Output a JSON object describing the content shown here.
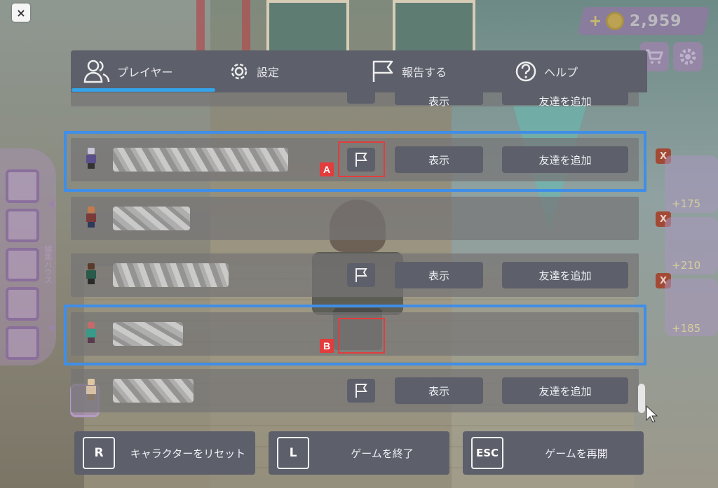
{
  "close_button": {
    "label": "×"
  },
  "currency": {
    "plus": "+",
    "amount": "2,959",
    "coin_icon": "gear-coin-icon"
  },
  "top_right_icons": [
    "shopping-cart-icon",
    "gear-icon"
  ],
  "left_toolbar": {
    "icons": [
      "hammer-wrench-icon",
      "frame-icon",
      "download-icon",
      "paint-roller-icon",
      "gear-icon"
    ],
    "vertical_label": "編集ハウス"
  },
  "inventory": [
    {
      "price": "+175",
      "icon": "fish-icon"
    },
    {
      "price": "+210",
      "icon": "computer-desk-icon"
    },
    {
      "price": "+185",
      "icon": "yellow-character-icon"
    }
  ],
  "inventory_remove_label": "X",
  "tabs": [
    {
      "label": "プレイヤー",
      "icon": "players-icon",
      "active": true
    },
    {
      "label": "設定",
      "icon": "gear-icon",
      "active": false
    },
    {
      "label": "報告する",
      "icon": "flag-icon",
      "active": false
    },
    {
      "label": "ヘルプ",
      "icon": "help-icon",
      "active": false
    }
  ],
  "players": [
    {
      "has_actions": true,
      "partial": true
    },
    {
      "has_actions": true,
      "annotation": "A"
    },
    {
      "has_actions": false
    },
    {
      "has_actions": true
    },
    {
      "has_actions": false,
      "annotation": "B"
    },
    {
      "has_actions": true
    }
  ],
  "row_actions": {
    "view": "表示",
    "add_friend": "友達を追加"
  },
  "annotations": {
    "a": "A",
    "b": "B"
  },
  "bottom_buttons": [
    {
      "key": "R",
      "label": "キャラクターをリセット"
    },
    {
      "key": "L",
      "label": "ゲームを終了"
    },
    {
      "key": "ESC",
      "label": "ゲームを再開"
    }
  ],
  "colors": {
    "panel": "#5d5f6a",
    "accent": "#35a3e8",
    "highlight": "#3f8ee8",
    "annotation": "#e23c3c"
  }
}
